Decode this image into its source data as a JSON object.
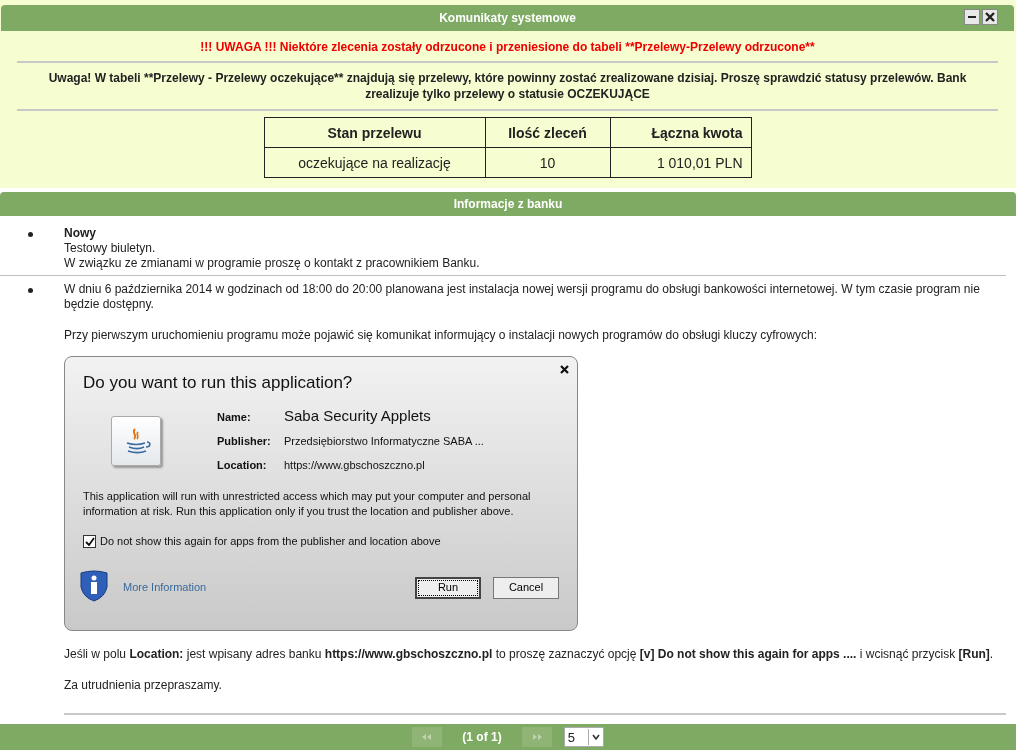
{
  "system_messages": {
    "title": "Komunikaty systemowe",
    "alert": "!!! UWAGA !!! Niektóre zlecenia zostały odrzucone i przeniesione do tabeli **Przelewy-Przelewy odrzucone**",
    "notice": "Uwaga! W tabeli **Przelewy - Przelewy oczekujące** znajdują się przelewy, które powinny zostać zrealizowane dzisiaj. Proszę sprawdzić statusy przelewów. Bank zrealizuje tylko przelewy o statusie OCZEKUJĄCE",
    "table": {
      "columns": [
        "Stan przelewu",
        "Ilość zleceń",
        "Łączna kwota"
      ],
      "rows": [
        [
          "oczekujące na realizację",
          "10",
          "1 010,01 PLN"
        ]
      ]
    }
  },
  "bank_info": {
    "title": "Informacje z banku",
    "items": [
      {
        "heading": "Nowy",
        "blocks": [
          {
            "kind": "line",
            "text": "Testowy biuletyn."
          },
          {
            "kind": "line",
            "text": "W związku ze zmianami w programie proszę o kontakt z pracownikiem Banku."
          }
        ]
      },
      {
        "blocks": [
          {
            "kind": "para",
            "text": "W dniu 6 października 2014 w godzinach od 18:00 do 20:00 planowana jest instalacja nowej wersji programu do obsługi bankowości internetowej. W tym czasie program nie będzie dostępny."
          },
          {
            "kind": "para",
            "text": "Przy pierwszym uruchomieniu programu może pojawić się komunikat informujący o instalacji nowych programów do obsługi kluczy cyfrowych:"
          },
          {
            "kind": "dialog",
            "title": "Do you want to run this application?",
            "fields": [
              {
                "label": "Name:",
                "value": "Saba Security Applets",
                "kind": "large"
              },
              {
                "label": "Publisher:",
                "value": "Przedsiębiorstwo Informatyczne SABA  ...",
                "kind": "normal"
              },
              {
                "label": "Location:",
                "value": "https://www.gbschoszczno.pl",
                "kind": "normal"
              }
            ],
            "warning": "This application will run with unrestricted access which may put your computer and personal information at risk. Run this application only if you trust the location and publisher above.",
            "checkbox": {
              "label": "Do not show this again for apps from the publisher and location above",
              "checked": true
            },
            "link": "More Information",
            "buttons": [
              {
                "label": "Run",
                "selected": true
              },
              {
                "label": "Cancel",
                "selected": false
              }
            ]
          },
          {
            "kind": "para",
            "text": "Jeśli w polu **Location:** jest wpisany adres banku **https://www.gbschoszczno.pl** to proszę zaznaczyć opcję **[v] Do not show this again for apps ....** i wcisnąć przycisk **[Run]**."
          },
          {
            "kind": "para",
            "text": "Za utrudnienia przepraszamy."
          }
        ]
      }
    ]
  },
  "paginator": {
    "first_disabled": true,
    "next_disabled": true,
    "page": "(1 of 1)",
    "page_size": "5"
  }
}
